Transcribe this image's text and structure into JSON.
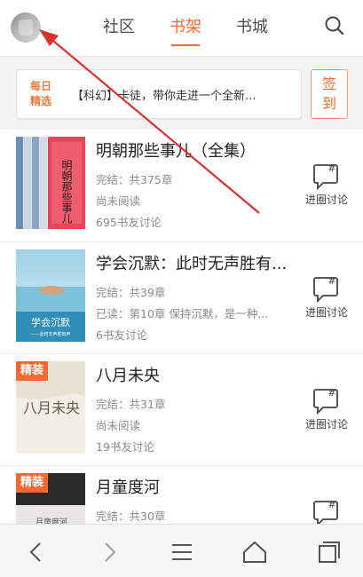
{
  "header": {
    "tabs": [
      {
        "label": "社区",
        "active": false
      },
      {
        "label": "书架",
        "active": true
      },
      {
        "label": "书城",
        "active": false
      }
    ],
    "search_icon": "search-icon",
    "avatar": "avatar"
  },
  "banner": {
    "tag_line1": "每日",
    "tag_line2": "精选",
    "text": "【科幻】卡徒，带你走进一个全新..."
  },
  "signin": {
    "line1": "签",
    "line2": "到"
  },
  "books": [
    {
      "title": "明朝那些事儿（全集）",
      "status": "完结：共375章",
      "progress": "尚未阅读",
      "discussions": "695书友讨论",
      "badge": "",
      "discuss_label": "进圈讨论",
      "cover_text": "明朝那些事儿"
    },
    {
      "title": "学会沉默：此时无声胜有...",
      "status": "完结：共39章",
      "progress": "已读：第10章 保持沉默，是一种...",
      "discussions": "6书友讨论",
      "badge": "",
      "discuss_label": "进圈讨论",
      "cover_text": "学会沉默",
      "cover_subtext": "——此时无声胜有声"
    },
    {
      "title": "八月未央",
      "status": "完结：共31章",
      "progress": "尚未阅读",
      "discussions": "19书友讨论",
      "badge": "精装",
      "discuss_label": "进圈讨论",
      "cover_text": "八月未央"
    },
    {
      "title": "月童度河",
      "status": "完结：共30章",
      "badge": "精装",
      "cover_text": "月童度河"
    }
  ],
  "bottom_nav": {
    "back_icon": "back-icon",
    "forward_icon": "forward-icon",
    "menu_icon": "menu-icon",
    "home_icon": "home-icon",
    "pages_icon": "pages-icon"
  },
  "colors": {
    "accent": "#f06a32",
    "annotation_arrow": "#d8322e"
  }
}
